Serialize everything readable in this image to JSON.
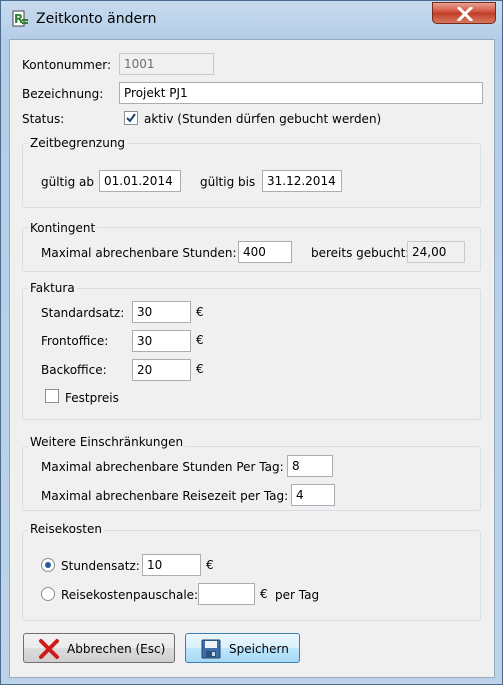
{
  "window": {
    "title": "Zeitkonto ändern"
  },
  "form": {
    "kontonummer_label": "Kontonummer:",
    "kontonummer_value": "1001",
    "bezeichnung_label": "Bezeichnung:",
    "bezeichnung_value": "Projekt PJ1",
    "status_label": "Status:",
    "status_checked": true,
    "status_text": "aktiv (Stunden dürfen gebucht werden)"
  },
  "zeitbegrenzung": {
    "title": "Zeitbegrenzung",
    "from_label": "gültig ab",
    "from_value": "01.01.2014",
    "to_label": "gültig bis",
    "to_value": "31.12.2014"
  },
  "kontingent": {
    "title": "Kontingent",
    "max_label": "Maximal abrechenbare Stunden:",
    "max_value": "400",
    "booked_label": "bereits gebucht:",
    "booked_value": "24,00"
  },
  "faktura": {
    "title": "Faktura",
    "standard_label": "Standardsatz:",
    "standard_value": "30",
    "front_label": "Frontoffice:",
    "front_value": "30",
    "back_label": "Backoffice:",
    "back_value": "20",
    "currency": "€",
    "festpreis_label": "Festpreis",
    "festpreis_checked": false
  },
  "einschraenkungen": {
    "title": "Weitere Einschränkungen",
    "per_day_label": "Maximal abrechenbare Stunden Per Tag:",
    "per_day_value": "8",
    "travel_label": "Maximal abrechenbare Reisezeit per Tag:",
    "travel_value": "4"
  },
  "reisekosten": {
    "title": "Reisekosten",
    "rate_label": "Stundensatz:",
    "rate_value": "10",
    "rate_selected": true,
    "lump_label": "Reisekostenpauschale:",
    "lump_value": "",
    "currency": "€",
    "per_day": "per Tag"
  },
  "buttons": {
    "cancel": "Abbrechen (Esc)",
    "save": "Speichern"
  },
  "icons": {
    "app": "app-logo-icon",
    "close": "close-icon",
    "cancel": "red-x-icon",
    "save": "floppy-disk-icon"
  }
}
